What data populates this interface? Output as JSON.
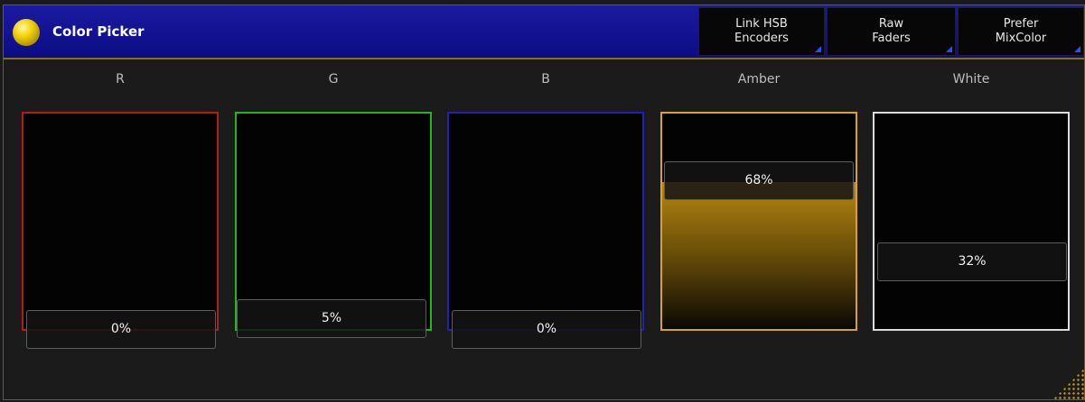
{
  "window": {
    "title": "Color Picker"
  },
  "toolbar": {
    "link_hsb": [
      "Link HSB",
      "Encoders"
    ],
    "raw_faders": [
      "Raw",
      "Faders"
    ],
    "prefer_mixcolor": [
      "Prefer",
      "MixColor"
    ]
  },
  "faders": [
    {
      "label": "R",
      "value": "0%",
      "level": 0,
      "color": "#b51b1b"
    },
    {
      "label": "G",
      "value": "5%",
      "level": 0.05,
      "color": "#21b521"
    },
    {
      "label": "B",
      "value": "0%",
      "level": 0,
      "color": "#1f22b3"
    },
    {
      "label": "Amber",
      "value": "68%",
      "level": 0.68,
      "color": "#d8a22b"
    },
    {
      "label": "White",
      "value": "32%",
      "level": 0.32,
      "color": "#dcdcdc"
    }
  ]
}
